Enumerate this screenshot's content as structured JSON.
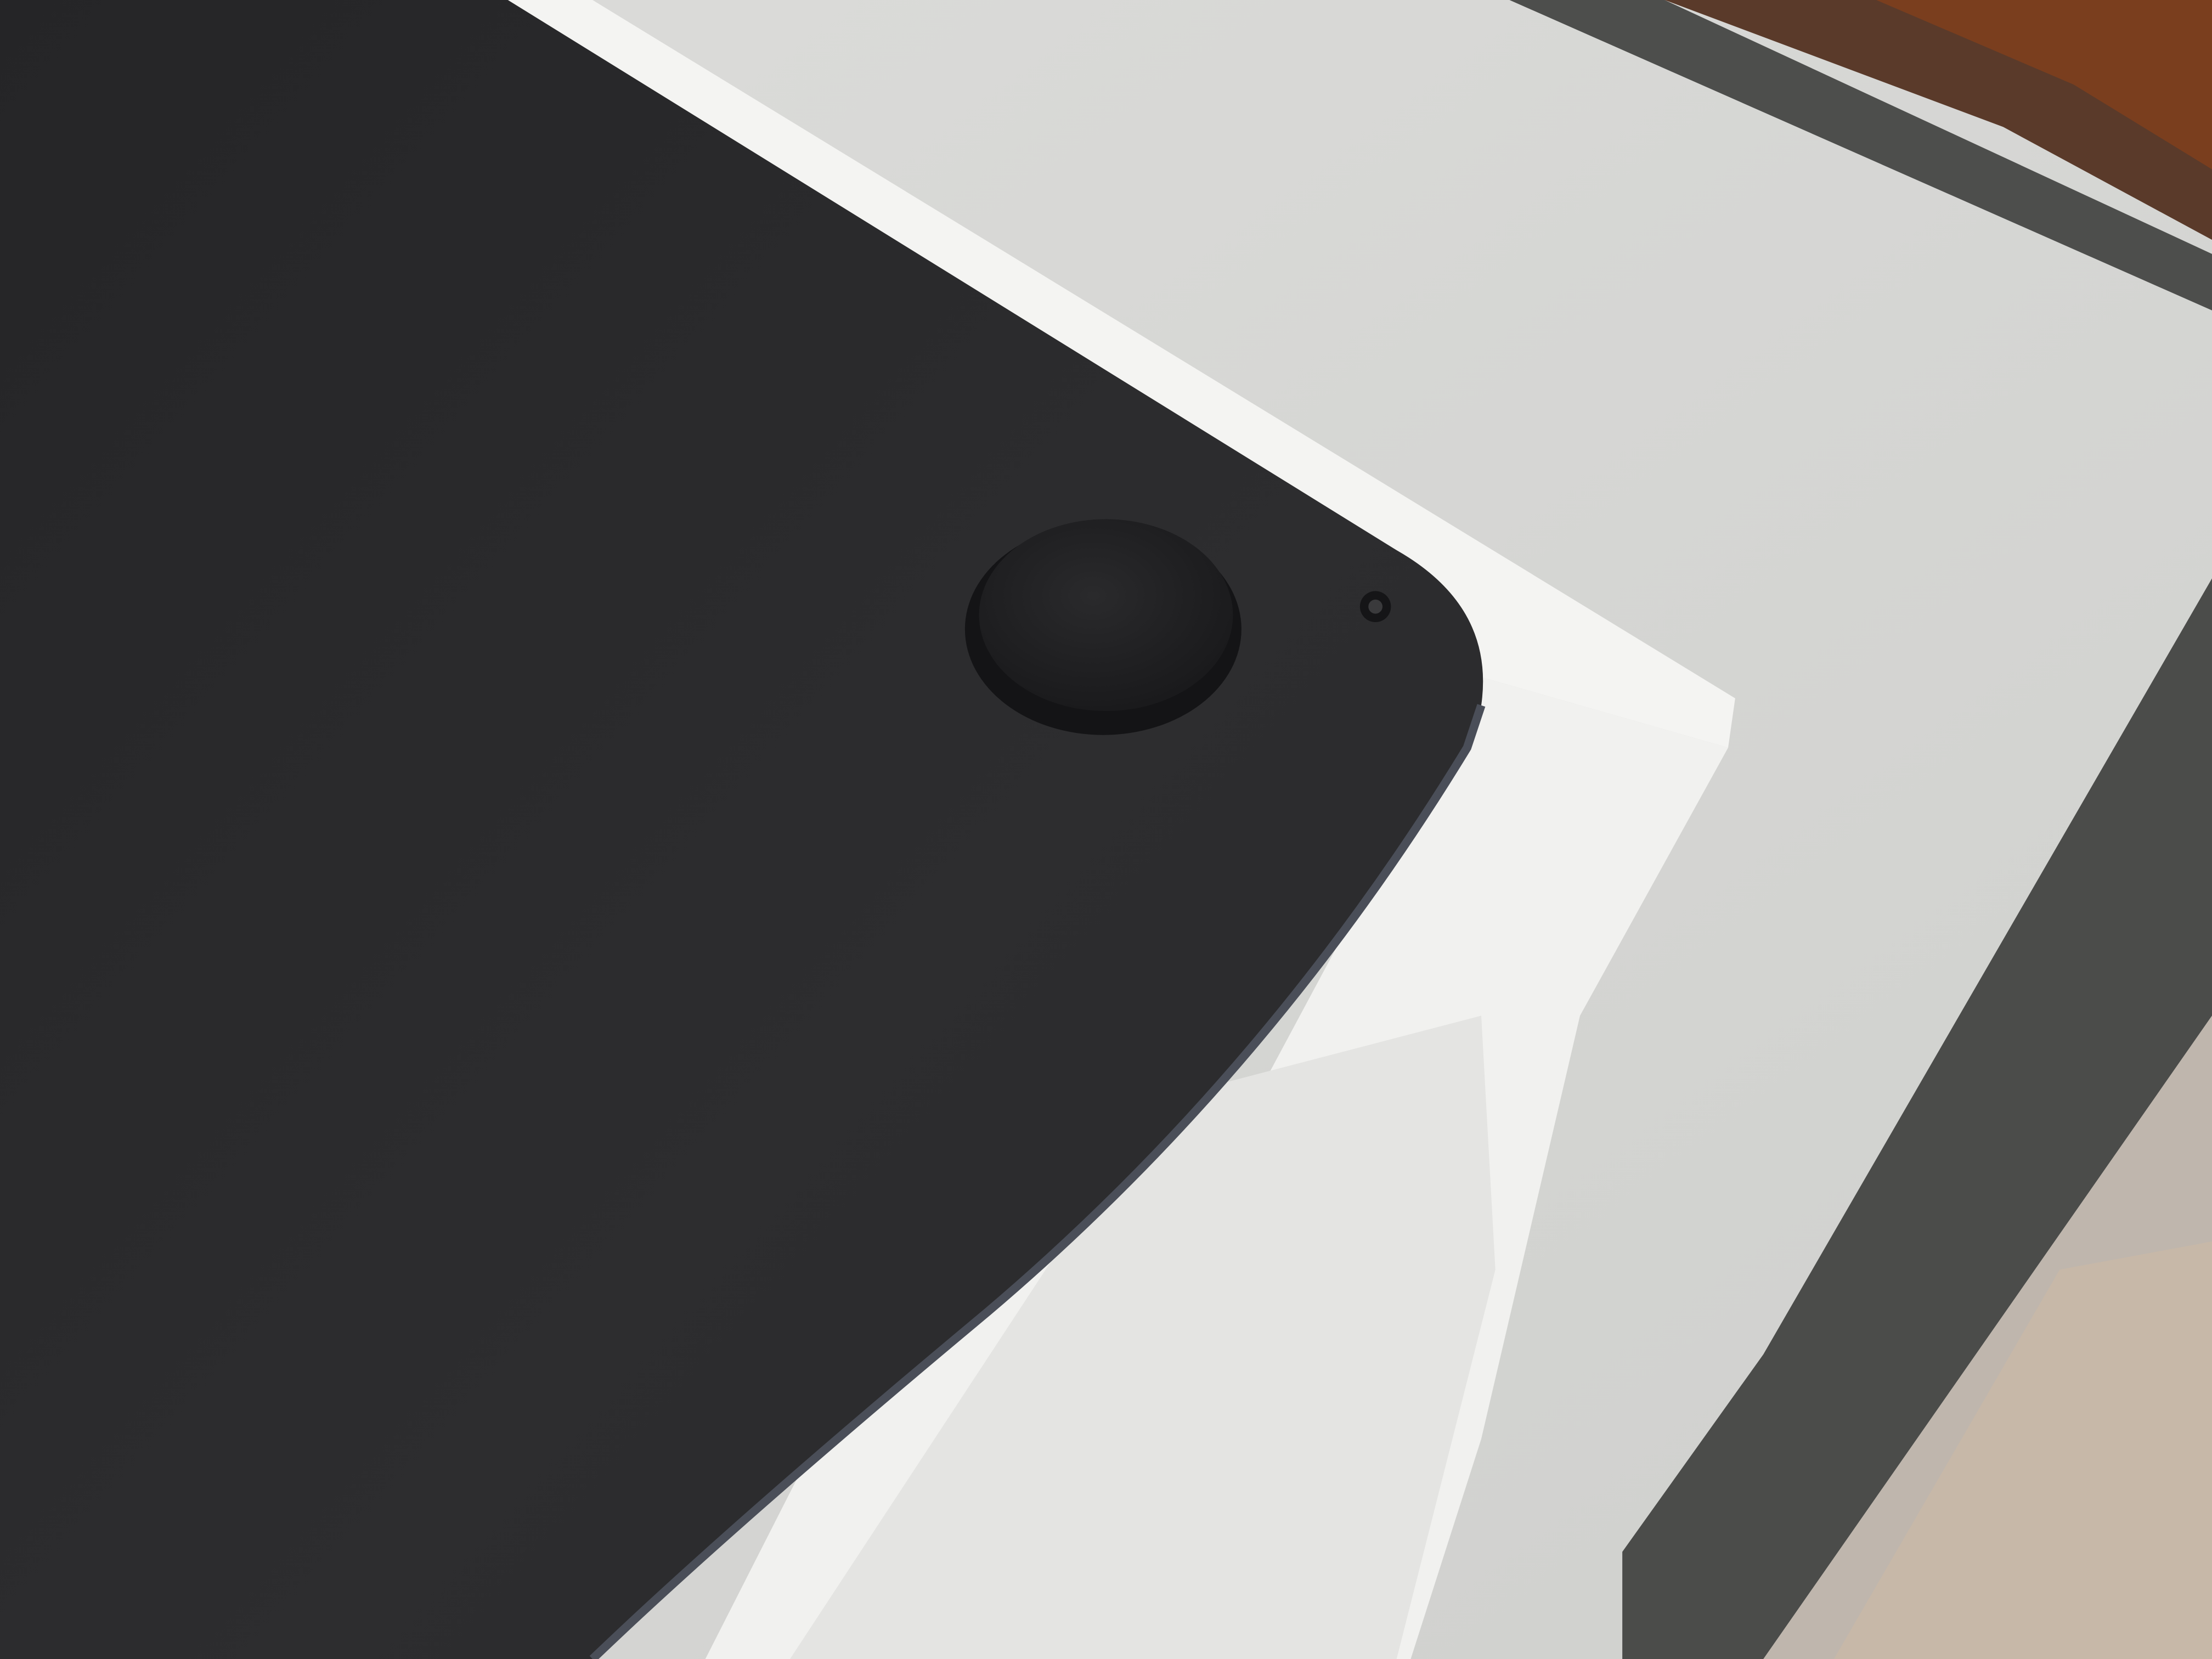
{
  "scene": {
    "subject": "laptop-bottom-corner",
    "colors": {
      "laptop_body": "#2a2a2c",
      "laptop_edge_highlight": "#4a4e58",
      "rubber_foot": "#1e1e20",
      "box_top": "#f4f4f2",
      "box_side": "#ececea",
      "desk_surface": "#d6d6d3",
      "frame_band": "#4b4c4a",
      "background_clutter": "#6b3a22"
    },
    "elements": [
      "laptop",
      "rubber-foot",
      "screw",
      "white-box",
      "desk-surface",
      "frame-band"
    ]
  }
}
